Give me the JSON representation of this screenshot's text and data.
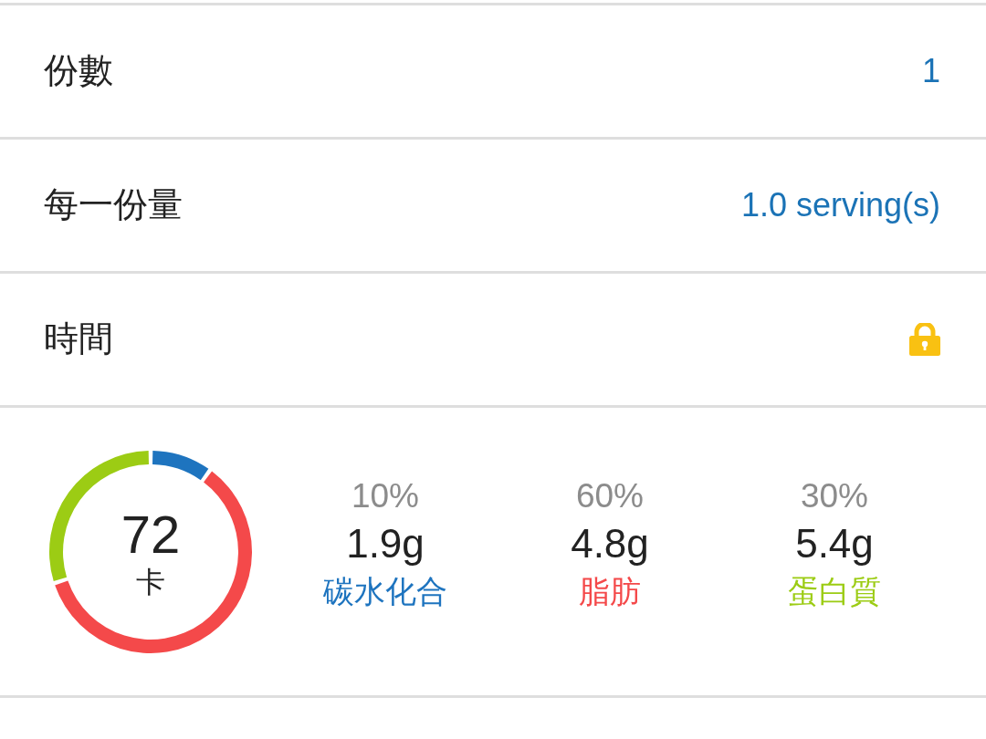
{
  "fields": [
    {
      "label": "份數",
      "value": "1",
      "locked": false
    },
    {
      "label": "每一份量",
      "value": "1.0 serving(s)",
      "locked": false
    },
    {
      "label": "時間",
      "locked": true
    }
  ],
  "nutrition": {
    "calories": "72",
    "unit": "卡",
    "chart_data": {
      "type": "donut",
      "values": [
        10,
        60,
        30
      ]
    },
    "macros": [
      {
        "percent": "10%",
        "amount": "1.9g",
        "name": "碳水化合",
        "color": "#1e74bf"
      },
      {
        "percent": "60%",
        "amount": "4.8g",
        "name": "脂肪",
        "color": "#f4494a"
      },
      {
        "percent": "30%",
        "amount": "5.4g",
        "name": "蛋白質",
        "color": "#9ccc14"
      }
    ]
  }
}
